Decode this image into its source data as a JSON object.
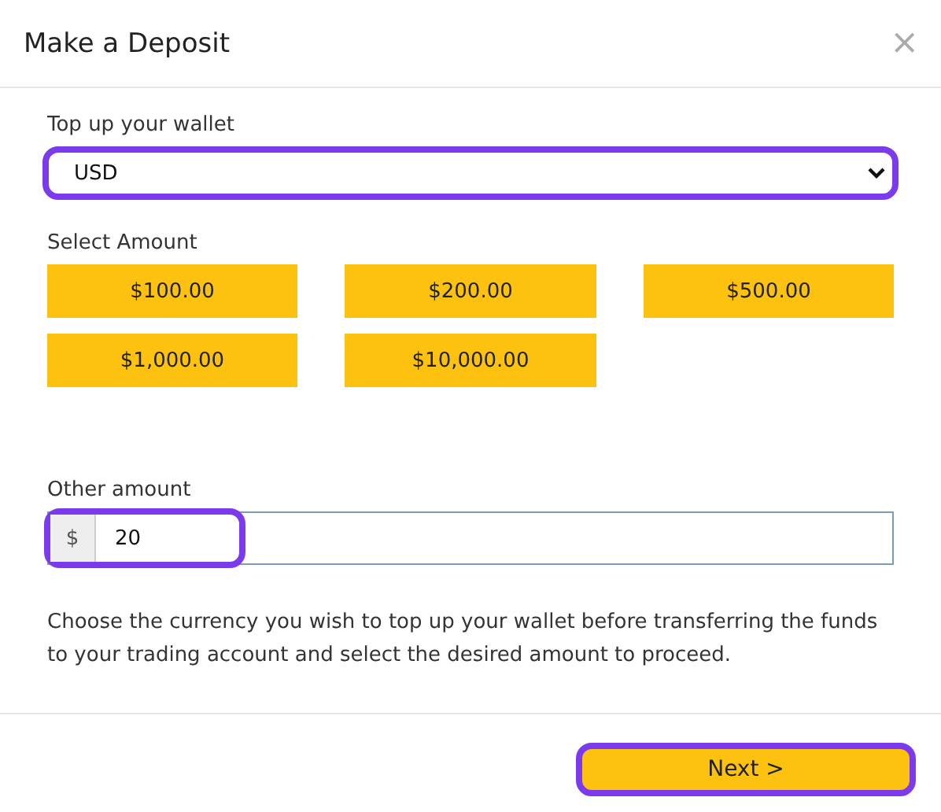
{
  "dialog": {
    "title": "Make a Deposit",
    "close": "×"
  },
  "wallet": {
    "label": "Top up your wallet",
    "value": "USD",
    "highlighted": true
  },
  "amounts": {
    "label": "Select Amount",
    "options": [
      {
        "label": "$100.00"
      },
      {
        "label": "$200.00"
      },
      {
        "label": "$500.00"
      },
      {
        "label": "$1,000.00"
      },
      {
        "label": "$10,000.00"
      }
    ]
  },
  "other_amount": {
    "label": "Other amount",
    "prefix": "$",
    "value": "20",
    "highlighted": true
  },
  "description": "Choose the currency you wish to top up your wallet before transferring the funds to your trading account and select the desired amount to proceed.",
  "next_button": {
    "label": "Next >",
    "highlighted": true
  }
}
